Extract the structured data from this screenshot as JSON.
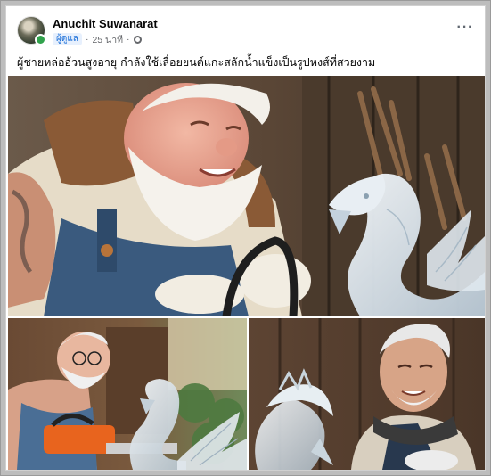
{
  "post": {
    "author_name": "Anuchit Suwanarat",
    "role_badge": "ผู้ดูแล",
    "separator": "·",
    "timestamp": "25 นาที",
    "separator2": "·",
    "audience_icon": "globe-icon",
    "more_icon": "more-options-icon",
    "more_label": "···",
    "text": "ผู้ชายหล่ออ้วนสูงอายุ กำลังใช้เลื่อยยนต์แกะสลักน้ำแข็งเป็นรูปหงส์ที่สวยงาม"
  },
  "photos": [
    {
      "id": "main",
      "alt": ""
    },
    {
      "id": "bottom-left",
      "alt": ""
    },
    {
      "id": "bottom-right",
      "alt": ""
    }
  ],
  "colors": {
    "badge_bg": "#e7f0fd",
    "badge_text": "#1b6fd8",
    "online": "#31a24c",
    "meta_text": "#65676b"
  }
}
